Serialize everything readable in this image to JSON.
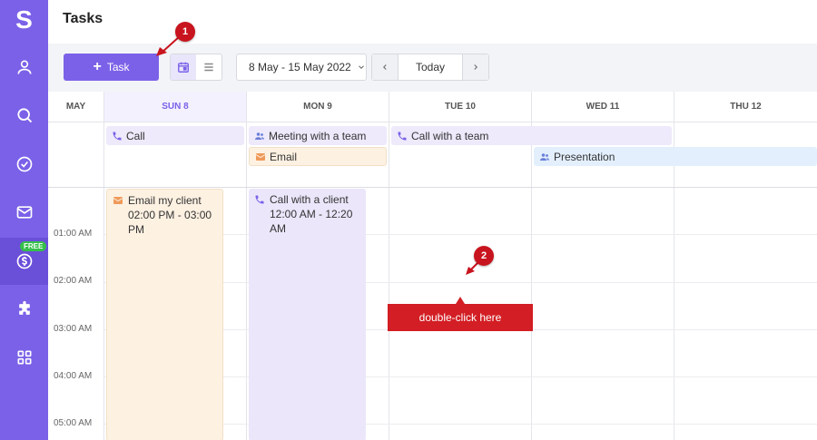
{
  "app": {
    "logo": "S",
    "page_title": "Tasks"
  },
  "sidebar": {
    "items": [
      {
        "icon": "user-icon"
      },
      {
        "icon": "search-icon"
      },
      {
        "icon": "check-circle-icon"
      },
      {
        "icon": "mail-icon"
      },
      {
        "icon": "dollar-icon",
        "badge": "FREE",
        "active": true
      },
      {
        "icon": "puzzle-icon"
      },
      {
        "icon": "grid-icon"
      }
    ]
  },
  "toolbar": {
    "add_task_label": "Task",
    "date_range": "8 May - 15 May 2022",
    "today_label": "Today"
  },
  "calendar": {
    "month_label": "MAY",
    "days": [
      "SUN 8",
      "MON 9",
      "TUE 10",
      "WED 11",
      "THU 12"
    ],
    "allday_events": [
      {
        "label": "Call",
        "icon": "phone-icon"
      },
      {
        "label": "Meeting with a team",
        "icon": "users-icon"
      },
      {
        "label": "Email",
        "icon": "mail-icon"
      },
      {
        "label": "Call with a team",
        "icon": "phone-icon"
      },
      {
        "label": "Presentation",
        "icon": "users-icon"
      }
    ],
    "time_labels": [
      "01:00 AM",
      "02:00 AM",
      "03:00 AM",
      "04:00 AM",
      "05:00 AM"
    ],
    "timed_events": [
      {
        "title": "Email my client",
        "time": "02:00 PM - 03:00 PM",
        "icon": "mail-icon"
      },
      {
        "title": "Call with a client",
        "time": "12:00 AM - 12:20 AM",
        "icon": "phone-icon"
      }
    ]
  },
  "annotations": {
    "marker_1": "1",
    "marker_2": "2",
    "tooltip": "double-click here"
  },
  "colors": {
    "accent": "#7b61e8",
    "annotation_red": "#c8141e"
  }
}
